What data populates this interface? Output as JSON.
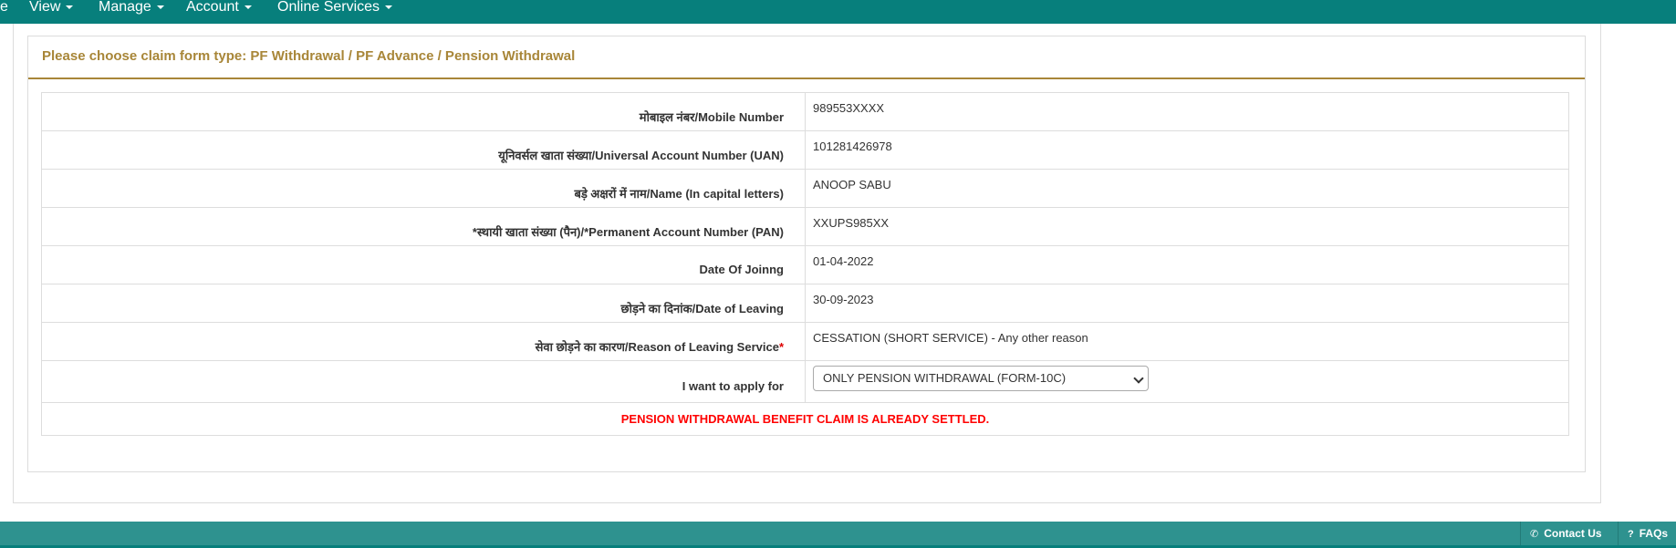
{
  "nav": {
    "cut_item": "e",
    "items": [
      {
        "label": "View"
      },
      {
        "label": "Manage"
      },
      {
        "label": "Account"
      },
      {
        "label": "Online Services"
      }
    ]
  },
  "panel": {
    "title": "Please choose claim form type: PF Withdrawal / PF Advance / Pension Withdrawal"
  },
  "rows": [
    {
      "label": "मोबाइल नंबर/Mobile Number",
      "value": "989553XXXX"
    },
    {
      "label": "यूनिवर्सल खाता संख्या/Universal Account Number (UAN)",
      "value": "101281426978"
    },
    {
      "label": "बड़े अक्षरों में नाम/Name (In capital letters)",
      "value": "ANOOP SABU"
    },
    {
      "label": "*स्थायी खाता संख्या (पैन)/*Permanent Account Number (PAN)",
      "value": "XXUPS985XX"
    },
    {
      "label": "Date Of Joinng",
      "value": "01-04-2022"
    },
    {
      "label": "छोड़ने का दिनांक/Date of Leaving",
      "value": "30-09-2023"
    },
    {
      "label": "सेवा छोड़ने का कारण/Reason of Leaving Service",
      "required_mark": "*",
      "value": "CESSATION (SHORT SERVICE) - Any other reason"
    }
  ],
  "apply": {
    "label": "I want to apply for",
    "selected": "ONLY PENSION WITHDRAWAL (FORM-10C)"
  },
  "message": "PENSION WITHDRAWAL BENEFIT CLAIM IS ALREADY SETTLED.",
  "footer": {
    "contact": "Contact Us",
    "faqs": "FAQs"
  },
  "colors": {
    "navbar": "#077f7c",
    "footer": "#2e928f",
    "title": "#a88638",
    "alert": "#ff0000"
  }
}
